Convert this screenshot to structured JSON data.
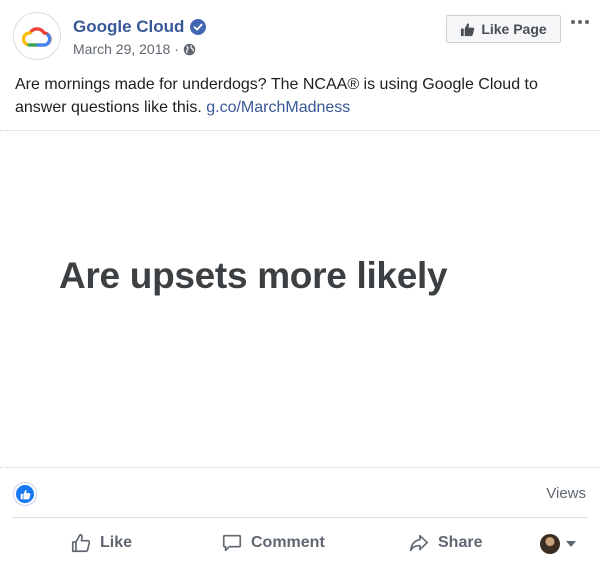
{
  "post": {
    "page_name": "Google Cloud",
    "date": "March 29, 2018",
    "separator": "·",
    "like_page_label": "Like Page",
    "text": "Are mornings made for underdogs? The NCAA® is using Google Cloud to answer questions like this.",
    "link": "g.co/MarchMadness"
  },
  "media": {
    "headline": "Are upsets more likely"
  },
  "stats": {
    "views_label": "Views"
  },
  "actions": {
    "like_label": "Like",
    "comment_label": "Comment",
    "share_label": "Share"
  },
  "colors": {
    "brand_link": "#385898",
    "like_blue": "#1877f2",
    "muted_text": "#606770"
  },
  "icons": [
    "google-cloud-logo",
    "verified-icon",
    "globe-icon",
    "thumbs-up-icon",
    "more-dots-icon",
    "comment-icon",
    "share-icon",
    "caret-down-icon"
  ]
}
